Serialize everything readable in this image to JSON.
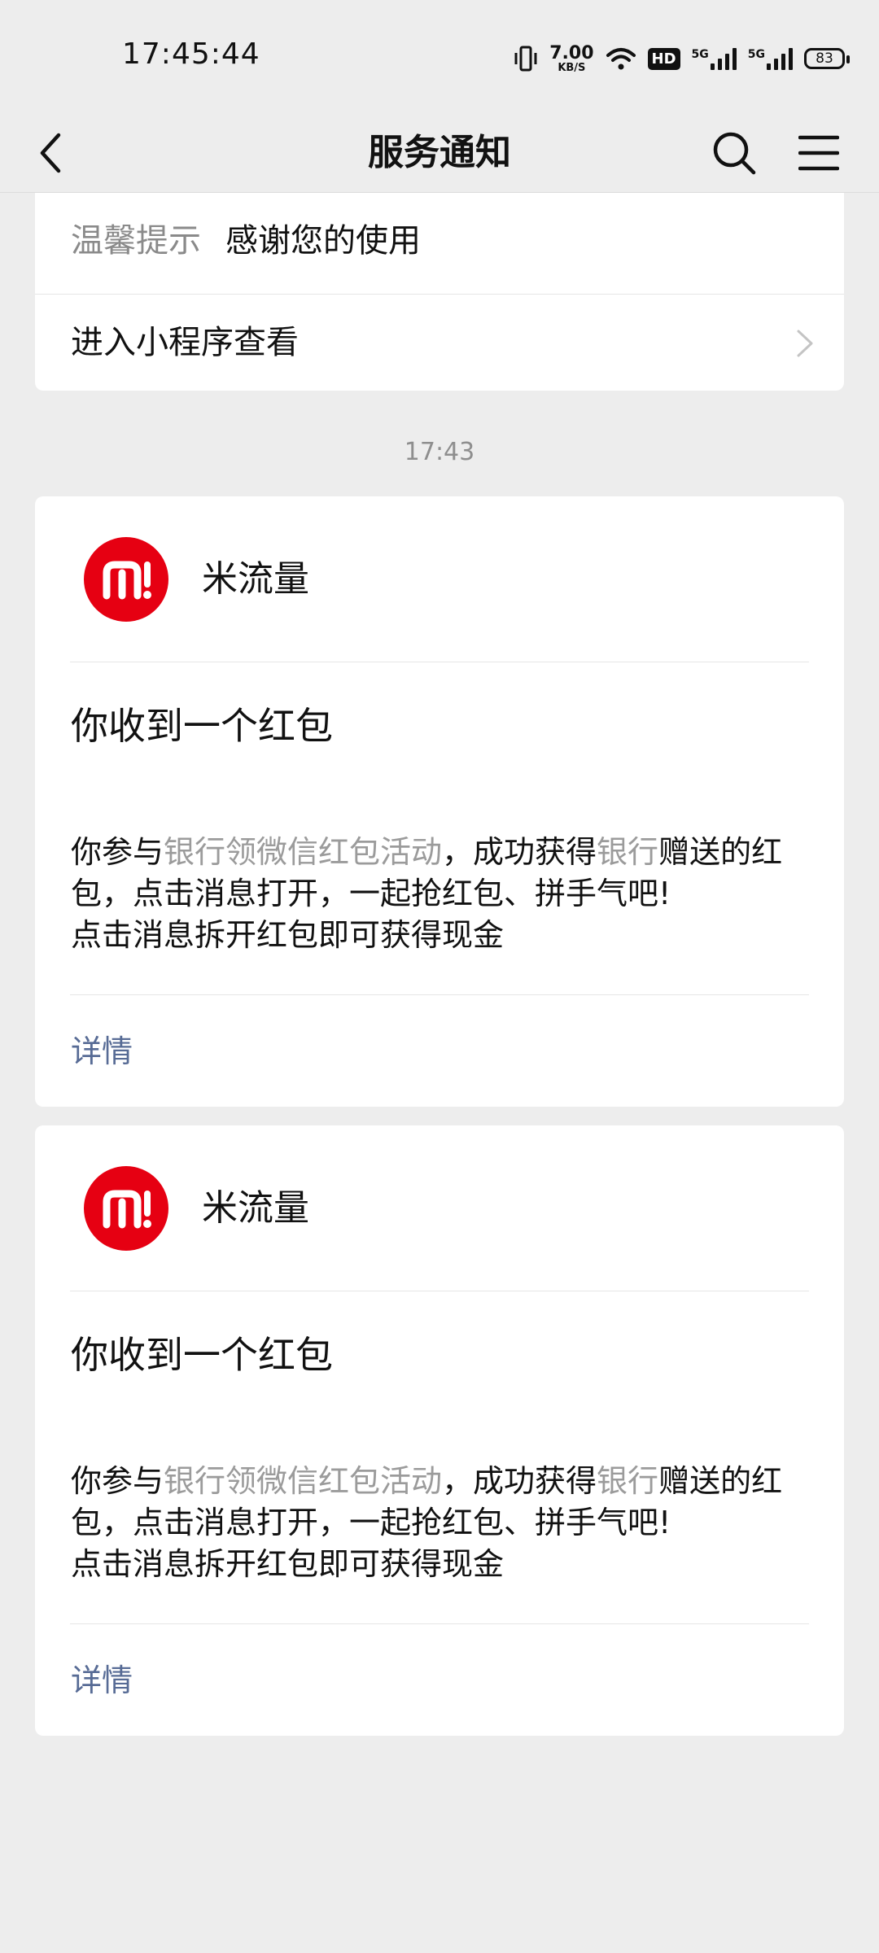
{
  "status_bar": {
    "time": "17:45:44",
    "net_speed_value": "7.00",
    "net_speed_unit": "KB/S",
    "hd_label": "HD",
    "sim1_label": "5G",
    "sim2_label": "5G",
    "battery": "83",
    "icons": [
      "vibrate-icon",
      "wifi-icon",
      "hd-icon",
      "signal-icon",
      "signal-icon",
      "battery-icon"
    ]
  },
  "nav": {
    "title": "服务通知",
    "back_icon": "chevron-left-icon",
    "search_icon": "search-icon",
    "menu_icon": "menu-icon"
  },
  "top_card": {
    "tip_label": "温馨提示",
    "tip_value": "感谢您的使用",
    "mini_program_label": "进入小程序查看"
  },
  "timestamp": "17:43",
  "messages": [
    {
      "sender": "米流量",
      "title": "你收到一个红包",
      "body_1": "你参与",
      "body_2": "银行领微信红包活动",
      "body_3": "，成功获得",
      "body_4": "银行",
      "body_5": "赠送的红包，点击消息打开，一起抢红包、拼手气吧!",
      "body_6": "点击消息拆开红包即可获得现金",
      "detail_label": "详情"
    },
    {
      "sender": "米流量",
      "title": "你收到一个红包",
      "body_1": "你参与",
      "body_2": "银行领微信红包活动",
      "body_3": "，成功获得",
      "body_4": "银行",
      "body_5": "赠送的红包，点击消息打开，一起抢红包、拼手气吧!",
      "body_6": "点击消息拆开红包即可获得现金",
      "detail_label": "详情"
    }
  ],
  "colors": {
    "background": "#ededed",
    "link": "#576b95",
    "muted": "#9b9b9b",
    "brand_red": "#e60012"
  }
}
